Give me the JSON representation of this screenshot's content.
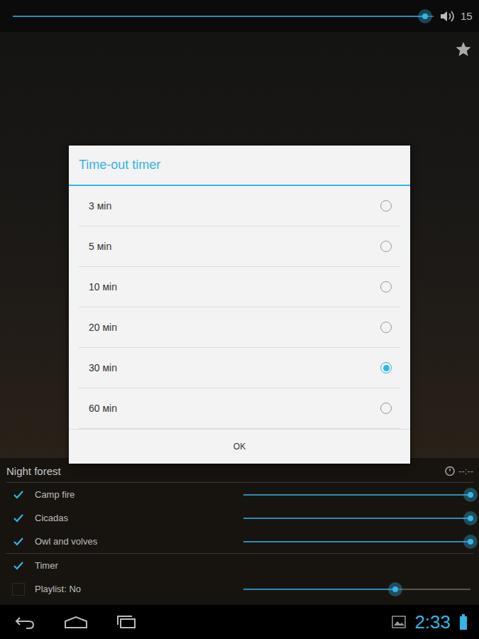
{
  "volume": {
    "level": 0.98,
    "reading": "15"
  },
  "dialog": {
    "title": "Time-out timer",
    "options": [
      {
        "label": "3 мin",
        "selected": false
      },
      {
        "label": "5 мin",
        "selected": false
      },
      {
        "label": "10 мin",
        "selected": false
      },
      {
        "label": "20 мin",
        "selected": false
      },
      {
        "label": "30 мin",
        "selected": true
      },
      {
        "label": "60 мin",
        "selected": false
      }
    ],
    "buttons": [
      "OK"
    ]
  },
  "scene": {
    "title": "Night forest",
    "timer": "--:--",
    "sounds": [
      {
        "kind": "slider",
        "label": "Camp fire",
        "checked": true,
        "level": 1.0
      },
      {
        "kind": "slider",
        "label": "Cicadas",
        "checked": true,
        "level": 1.0
      },
      {
        "kind": "slider",
        "label": "Owl and volves",
        "checked": true,
        "level": 1.0
      }
    ],
    "options": [
      {
        "kind": "toggle",
        "label": "Timer",
        "checked": true,
        "level": 0
      },
      {
        "kind": "slider",
        "label": "Playlist: No",
        "checked": false,
        "level": 0.67
      }
    ]
  },
  "status_bar": {
    "time": "2:33"
  }
}
